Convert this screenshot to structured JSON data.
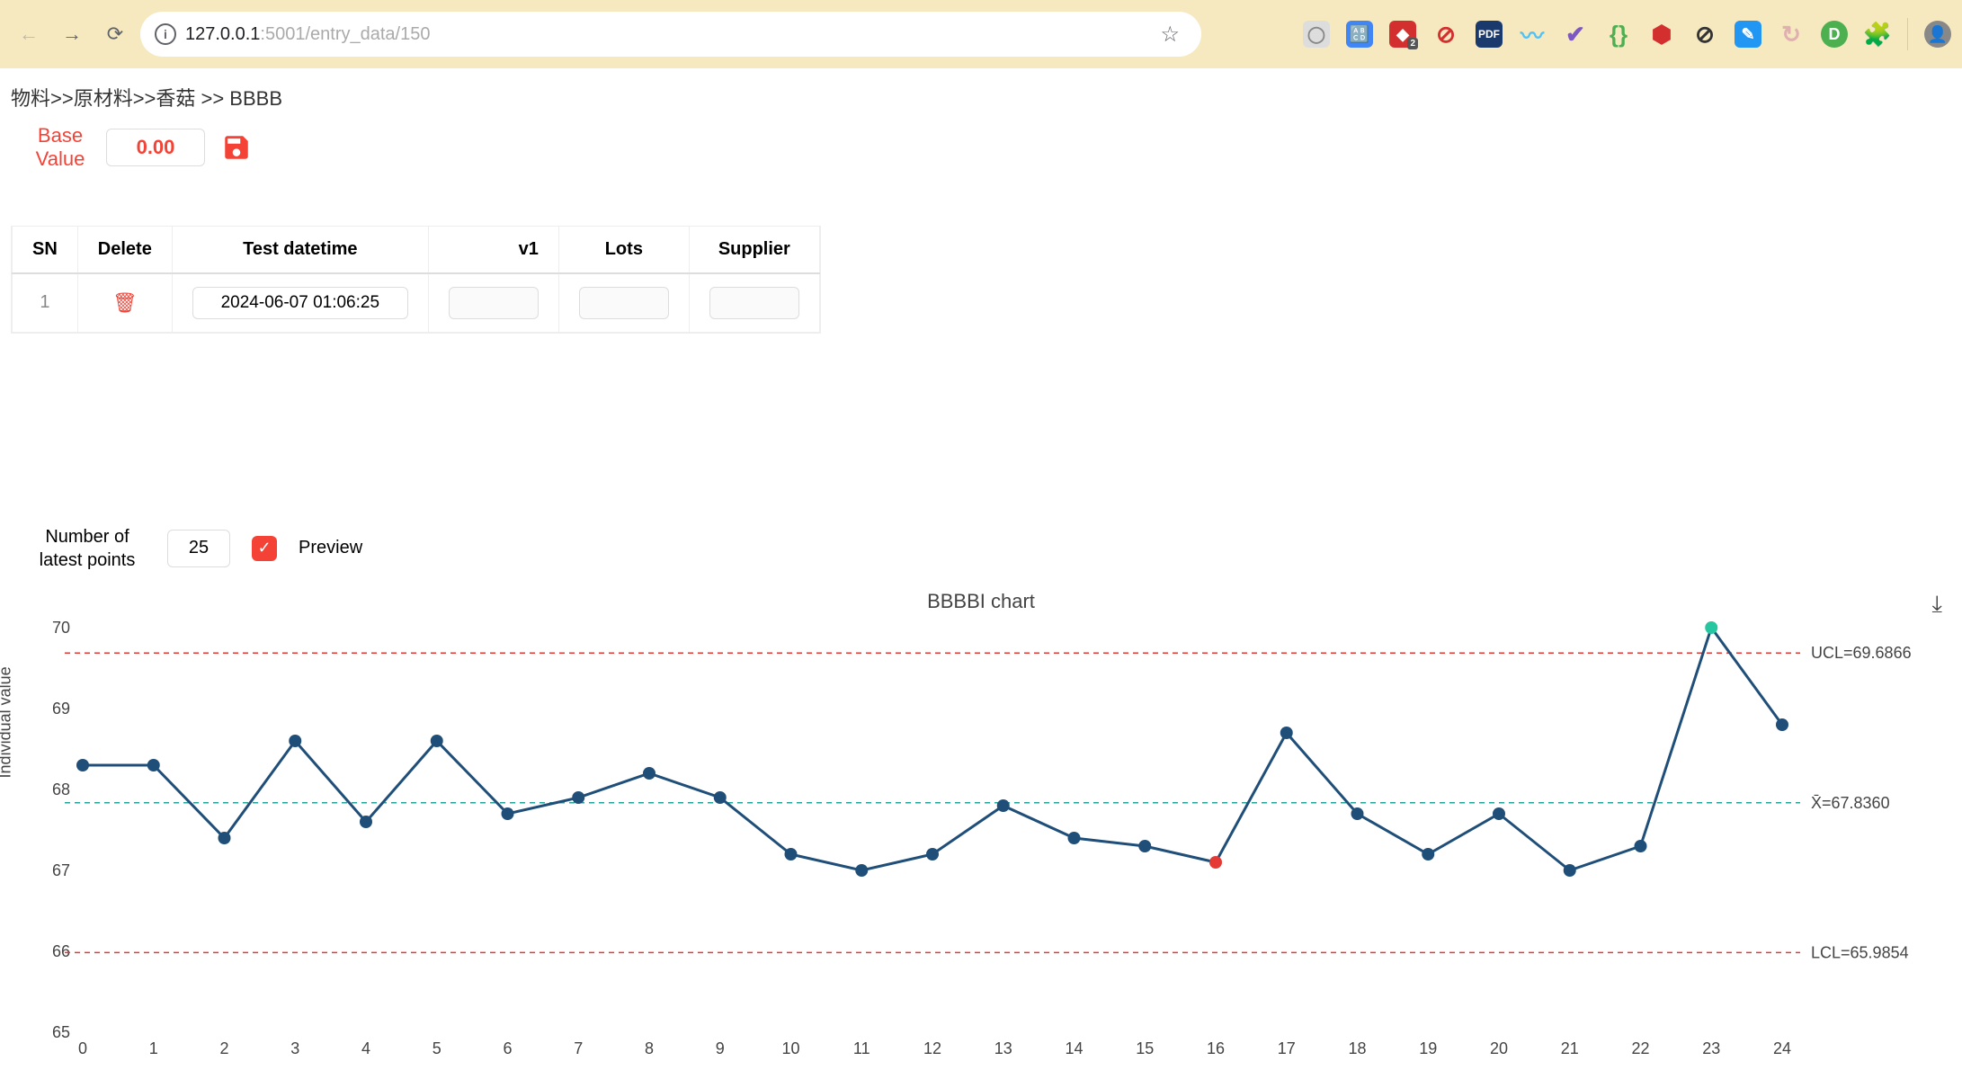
{
  "browser": {
    "url_prefix": "127.0.0.1",
    "url_suffix": ":5001/entry_data/150"
  },
  "breadcrumb": "物料>>原材料>>香菇 >> BBBB",
  "base": {
    "label1": "Base",
    "label2": "Value",
    "value": "0.00"
  },
  "table": {
    "headers": [
      "SN",
      "Delete",
      "Test datetime",
      "v1",
      "Lots",
      "Supplier"
    ],
    "rows": [
      {
        "sn": "1",
        "datetime": "2024-06-07 01:06:25",
        "v1": "",
        "lots": "",
        "supplier": ""
      }
    ]
  },
  "points": {
    "label1": "Number of",
    "label2": "latest points",
    "value": "25",
    "preview_label": "Preview"
  },
  "chart_data": {
    "type": "line",
    "title": "BBBBI chart",
    "ylabel": "Individual value",
    "x": [
      0,
      1,
      2,
      3,
      4,
      5,
      6,
      7,
      8,
      9,
      10,
      11,
      12,
      13,
      14,
      15,
      16,
      17,
      18,
      19,
      20,
      21,
      22,
      23,
      24
    ],
    "values": [
      68.3,
      68.3,
      67.4,
      68.6,
      67.6,
      68.6,
      67.7,
      67.9,
      68.2,
      67.9,
      67.2,
      67.0,
      67.2,
      67.8,
      67.4,
      67.3,
      67.1,
      68.7,
      67.7,
      67.2,
      67.7,
      67.0,
      67.3,
      70.0,
      68.8
    ],
    "point_colors": [
      "blue",
      "blue",
      "blue",
      "blue",
      "blue",
      "blue",
      "blue",
      "blue",
      "blue",
      "blue",
      "blue",
      "blue",
      "blue",
      "blue",
      "blue",
      "blue",
      "red",
      "blue",
      "blue",
      "blue",
      "blue",
      "blue",
      "blue",
      "green",
      "blue"
    ],
    "y_ticks": [
      65,
      66,
      67,
      68,
      69,
      70
    ],
    "ylim": [
      65,
      70
    ],
    "ucl": 69.6866,
    "mean": 67.836,
    "lcl": 65.9854,
    "ucl_label": "UCL=69.6866",
    "mean_label": "X̄=67.8360",
    "lcl_label": "LCL=65.9854"
  }
}
